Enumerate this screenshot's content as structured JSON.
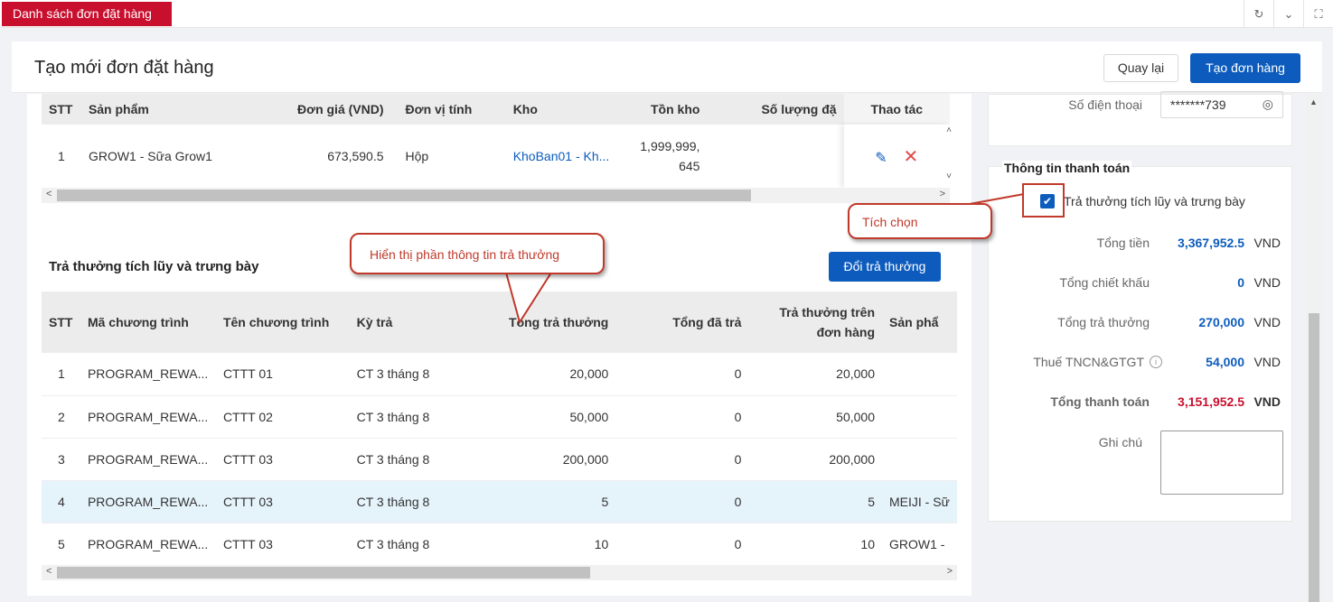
{
  "topbar": {
    "tab_label": "Danh sách đơn đặt hàng"
  },
  "header": {
    "title": "Tạo mới đơn đặt hàng",
    "back_label": "Quay lại",
    "create_label": "Tạo đơn hàng"
  },
  "products": {
    "columns": [
      "STT",
      "Sản phẩm",
      "Đơn giá (VND)",
      "Đơn vị tính",
      "Kho",
      "Tồn kho",
      "Số lượng đặ",
      "Thao tác"
    ],
    "rows": [
      {
        "stt": "1",
        "product": "GROW1 - Sữa Grow1",
        "price": "673,590.5",
        "unit": "Hộp",
        "warehouse": "KhoBan01 - Kh...",
        "stock_line1": "1,999,999,",
        "stock_line2": "645"
      }
    ]
  },
  "rewards": {
    "title": "Trả thưởng tích lũy và trưng bày",
    "swap_label": "Đổi trả thưởng",
    "columns": [
      "STT",
      "Mã chương trình",
      "Tên chương trình",
      "Kỳ trả",
      "Tổng trả thưởng",
      "Tổng đã trả",
      "Trả thưởng trên",
      "đơn hàng",
      "Sản phẩ"
    ],
    "rows": [
      {
        "stt": "1",
        "code": "PROGRAM_REWA...",
        "name": "CTTT 01",
        "period": "CT 3 tháng 8",
        "total": "20,000",
        "paid": "0",
        "on_order": "20,000",
        "product": ""
      },
      {
        "stt": "2",
        "code": "PROGRAM_REWA...",
        "name": "CTTT 02",
        "period": "CT 3 tháng 8",
        "total": "50,000",
        "paid": "0",
        "on_order": "50,000",
        "product": ""
      },
      {
        "stt": "3",
        "code": "PROGRAM_REWA...",
        "name": "CTTT 03",
        "period": "CT 3 tháng 8",
        "total": "200,000",
        "paid": "0",
        "on_order": "200,000",
        "product": ""
      },
      {
        "stt": "4",
        "code": "PROGRAM_REWA...",
        "name": "CTTT 03",
        "period": "CT 3 tháng 8",
        "total": "5",
        "paid": "0",
        "on_order": "5",
        "product": "MEIJI - Sữ"
      },
      {
        "stt": "5",
        "code": "PROGRAM_REWA...",
        "name": "CTTT 03",
        "period": "CT 3 tháng 8",
        "total": "10",
        "paid": "0",
        "on_order": "10",
        "product": "GROW1 -"
      }
    ]
  },
  "contact": {
    "phone_label": "Số điện thoại",
    "phone_value": "*******739"
  },
  "payment": {
    "title": "Thông tin thanh toán",
    "checkbox_label": "Trả thưởng tích lũy và trưng bày",
    "checked": true,
    "rows": [
      {
        "label": "Tổng tiền",
        "value": "3,367,952.5",
        "unit": "VND"
      },
      {
        "label": "Tổng chiết khấu",
        "value": "0",
        "unit": "VND"
      },
      {
        "label": "Tổng trả thưởng",
        "value": "270,000",
        "unit": "VND"
      },
      {
        "label": "Thuế TNCN&GTGT",
        "value": "54,000",
        "unit": "VND"
      },
      {
        "label": "Tổng thanh toán",
        "value": "3,151,952.5",
        "unit": "VND"
      }
    ],
    "note_label": "Ghi chú",
    "value_color": "#0d5cbd",
    "total_color": "#c8102e"
  },
  "annotations": {
    "callout_reward": "Hiển thị phần thông tin trả thưởng",
    "callout_tick": "Tích chọn"
  }
}
